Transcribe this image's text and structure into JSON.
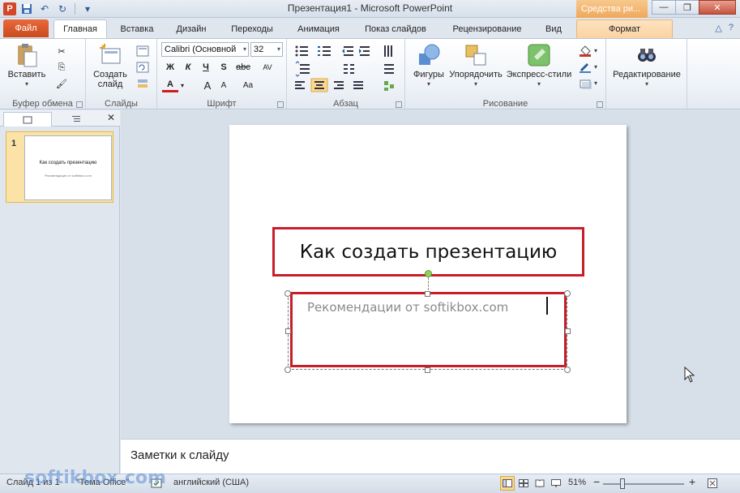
{
  "window": {
    "title": "Презентация1  -  Microsoft PowerPoint",
    "context_tab_title": "Средства ри...",
    "minimize_symbol": "—",
    "maximize_symbol": "❐",
    "close_symbol": "✕"
  },
  "qat": {
    "app_letter": "P",
    "save_symbol": "💾",
    "undo_symbol": "↶",
    "redo_symbol": "↻",
    "customize_symbol": "▾"
  },
  "tabs": {
    "file": "Файл",
    "items": [
      "Главная",
      "Вставка",
      "Дизайн",
      "Переходы",
      "Анимация",
      "Показ слайдов",
      "Рецензирование",
      "Вид"
    ],
    "format": "Формат",
    "help_up": "△",
    "help_q": "?"
  },
  "ribbon": {
    "clipboard": {
      "label": "Буфер обмена",
      "paste": "Вставить",
      "cut_symbol": "✂",
      "copy_symbol": "⎘",
      "painter_symbol": "🖌"
    },
    "slides": {
      "label": "Слайды",
      "new_slide_line1": "Создать",
      "new_slide_line2": "слайд"
    },
    "font": {
      "label": "Шрифт",
      "font_name": "Calibri (Основной",
      "font_size": "32",
      "bold": "Ж",
      "italic": "К",
      "underline": "Ч",
      "shadow": "S",
      "strike": "abc",
      "spacing": "AV",
      "color": "A",
      "grow": "A",
      "shrink": "A",
      "case": "Aa"
    },
    "paragraph": {
      "label": "Абзац"
    },
    "drawing": {
      "label": "Рисование",
      "shapes": "Фигуры",
      "arrange": "Упорядочить",
      "quick_styles": "Экспресс-стили"
    },
    "editing": {
      "label": "Редактирование"
    }
  },
  "slides_pane": {
    "slide_number": "1",
    "close_symbol": "✕",
    "thumb_title": "Как создать презентацию",
    "thumb_subtitle": "Рекомендации от softikbox.com"
  },
  "slide": {
    "title": "Как создать презентацию",
    "subtitle": "Рекомендации от softikbox.com"
  },
  "notes": {
    "placeholder": "Заметки к слайду"
  },
  "status": {
    "slide_info": "Слайд 1 из 1",
    "theme": "\"Тема Office\"",
    "language": "английский (США)",
    "zoom": "51%",
    "zoom_minus": "−",
    "zoom_plus": "+"
  },
  "watermark": "softikbox.com",
  "colors": {
    "highlight_red": "#c81e2a",
    "file_tab": "#d24726",
    "context_tab": "#efa85a"
  }
}
